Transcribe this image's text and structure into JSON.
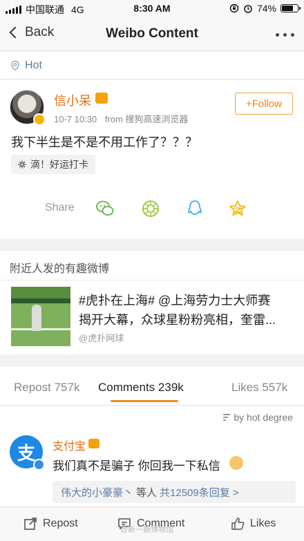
{
  "status_bar": {
    "carrier": "中国联通",
    "network": "4G",
    "time": "8:30 AM",
    "battery_level": 74,
    "battery_text": "74%"
  },
  "nav": {
    "back_label": "Back",
    "title": "Weibo Content"
  },
  "hot_label": "Hot",
  "post": {
    "username": "信小呆",
    "date": "10-7 10:30",
    "source": "from 搜狗高速浏览器",
    "follow_label": "+Follow",
    "text": "我下半生是不是不用工作了？？？",
    "tag": "滴！好运打卡",
    "share_label": "Share",
    "share_icons": [
      "wechat-icon",
      "moments-icon",
      "qq-icon",
      "qzone-icon"
    ]
  },
  "nearby": {
    "heading": "附近人发的有趣微博",
    "line1": "#虎扑在上海# @上海劳力士大师赛",
    "line2": "揭开大幕，众球星粉粉亮相，奎雷...",
    "source": "@虎扑网球"
  },
  "tabs": [
    {
      "label": "Repost 757k",
      "active": false
    },
    {
      "label": "Comments 239k",
      "active": true
    },
    {
      "label": "Likes 557k",
      "active": false
    }
  ],
  "comments": {
    "sort_label": "by hot degree",
    "items": [
      {
        "name": "支付宝",
        "avatar_text": "支",
        "text": "我们真不是骗子 你回我一下私信",
        "reply_user": "伟大的小豪豪丶",
        "reply_etc": "等人",
        "reply_count": "共12509条回复 >"
      }
    ]
  },
  "bottom_bar": {
    "repost_label": "Repost",
    "comment_label": "Comment",
    "likes_label": "Likes"
  },
  "watermark": "@新一期博物馆",
  "colors": {
    "accent_orange": "#e86b0c",
    "link_blue": "#5b7ea8",
    "tab_underline": "#f08b1a"
  }
}
